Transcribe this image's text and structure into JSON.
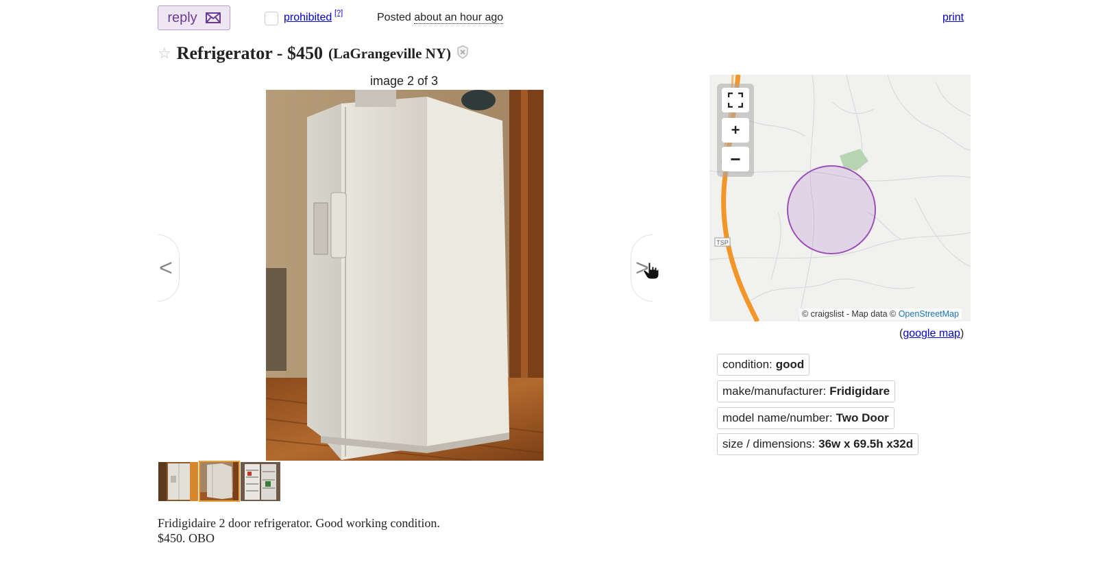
{
  "topbar": {
    "reply_label": "reply",
    "prohibited_label": "prohibited",
    "prohibited_help": "[?]",
    "posted_prefix": "Posted",
    "posted_time": "about an hour ago",
    "print_label": "print"
  },
  "title": {
    "text": "Refrigerator - $450",
    "location": "(LaGrangeville NY)"
  },
  "gallery": {
    "counter": "image 2 of 3",
    "prev_label": "<",
    "next_label": ">",
    "thumbnail_count": 3,
    "selected_thumbnail": 2
  },
  "body": {
    "line1": "Fridigidaire 2 door refrigerator. Good working condition.",
    "line2": "$450. OBO"
  },
  "map": {
    "attribution_prefix": "© craigslist - Map data ©",
    "attribution_link": "OpenStreetMap",
    "google_open": "(",
    "google_link": "google map",
    "google_close": ")",
    "highway_label": "TSP",
    "zoom_in": "+",
    "zoom_out": "−",
    "route_color": "#f2962a",
    "area_color": "#b57fcb"
  },
  "attributes": [
    {
      "label": "condition:",
      "value": "good"
    },
    {
      "label": "make/manufacturer:",
      "value": "Fridigidare"
    },
    {
      "label": "model name/number:",
      "value": "Two Door"
    },
    {
      "label": "size / dimensions:",
      "value": "36w x 69.5h x32d"
    }
  ],
  "colors": {
    "link": "#0000cc",
    "reply_bg": "#eee6f3",
    "reply_text": "#6a3a93",
    "thumb_selected": "#e8a33d"
  }
}
